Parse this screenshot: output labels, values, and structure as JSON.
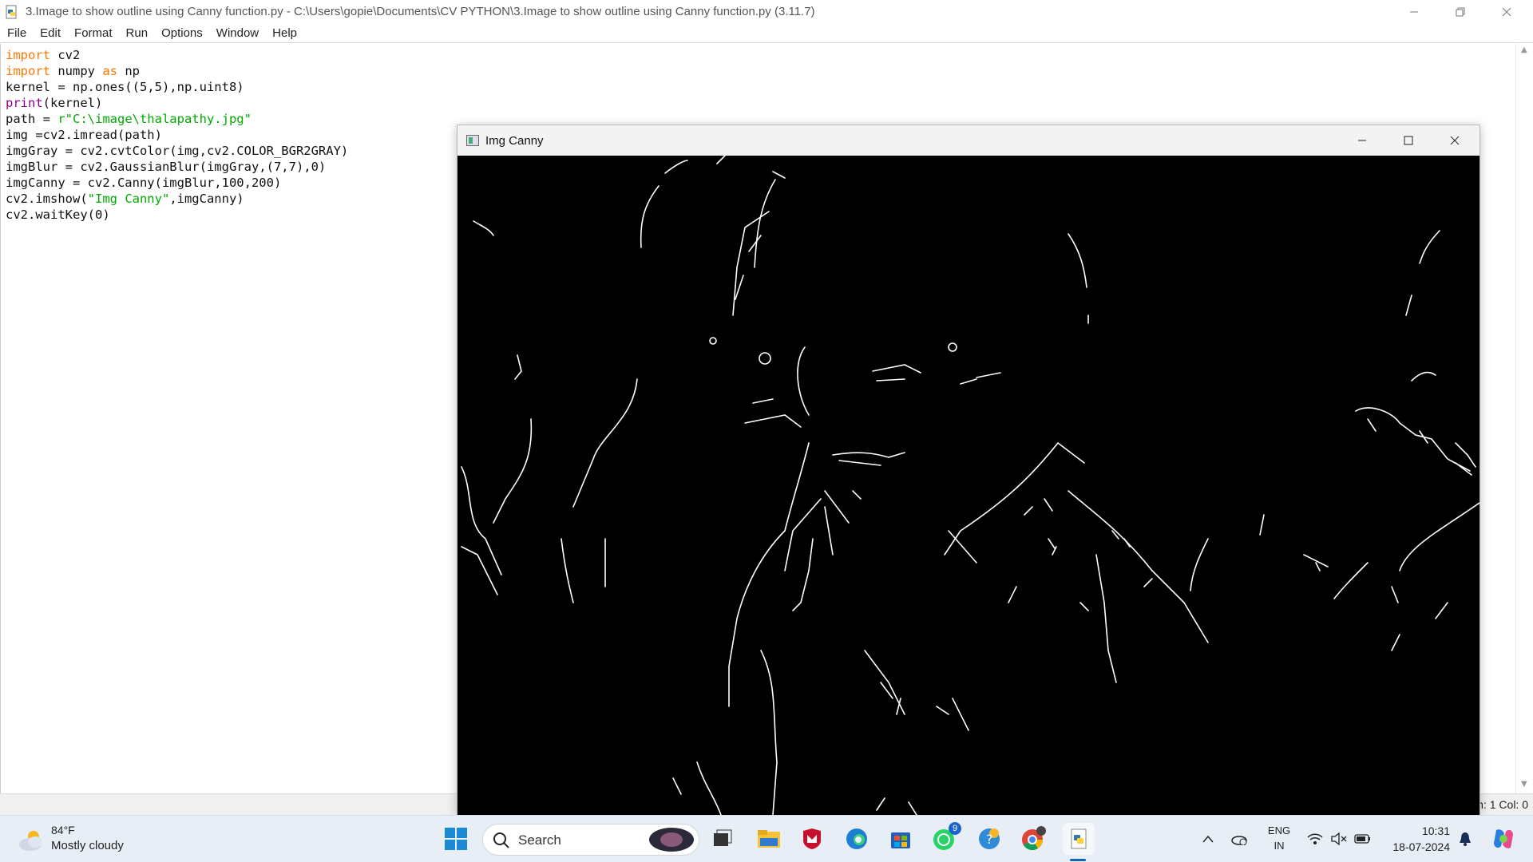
{
  "editor": {
    "title": "3.Image to show outline using Canny function.py - C:\\Users\\gopie\\Documents\\CV PYTHON\\3.Image to show outline using Canny function.py (3.11.7)",
    "menu": [
      "File",
      "Edit",
      "Format",
      "Run",
      "Options",
      "Window",
      "Help"
    ],
    "status": "Ln: 1   Col: 0",
    "code_lines": [
      [
        {
          "t": "import",
          "c": "kw"
        },
        {
          "t": " cv2",
          "c": ""
        }
      ],
      [
        {
          "t": "import",
          "c": "kw"
        },
        {
          "t": " numpy ",
          "c": ""
        },
        {
          "t": "as",
          "c": "kw"
        },
        {
          "t": " np",
          "c": ""
        }
      ],
      [
        {
          "t": "kernel = np.ones((5,5),np.uint8)",
          "c": ""
        }
      ],
      [
        {
          "t": "print",
          "c": "bi"
        },
        {
          "t": "(kernel)",
          "c": ""
        }
      ],
      [
        {
          "t": "path = ",
          "c": ""
        },
        {
          "t": "r\"C:\\image\\thalapathy.jpg\"",
          "c": "str"
        }
      ],
      [
        {
          "t": "img =cv2.imread(path)",
          "c": ""
        }
      ],
      [
        {
          "t": "imgGray = cv2.cvtColor(img,cv2.COLOR_BGR2GRAY)",
          "c": ""
        }
      ],
      [
        {
          "t": "imgBlur = cv2.GaussianBlur(imgGray,(7,7),0)",
          "c": ""
        }
      ],
      [
        {
          "t": "imgCanny = cv2.Canny(imgBlur,100,200)",
          "c": ""
        }
      ],
      [
        {
          "t": "cv2.imshow(",
          "c": ""
        },
        {
          "t": "\"Img Canny\"",
          "c": "str"
        },
        {
          "t": ",imgCanny)",
          "c": ""
        }
      ],
      [
        {
          "t": "cv2.waitKey(0)",
          "c": ""
        }
      ]
    ]
  },
  "canny_window": {
    "title": "Img Canny"
  },
  "taskbar": {
    "weather_temp": "84°F",
    "weather_condition": "Mostly cloudy",
    "search_label": "Search",
    "whatsapp_badge": "9",
    "lang_top": "ENG",
    "lang_bottom": "IN",
    "time": "10:31",
    "date": "18-07-2024"
  }
}
